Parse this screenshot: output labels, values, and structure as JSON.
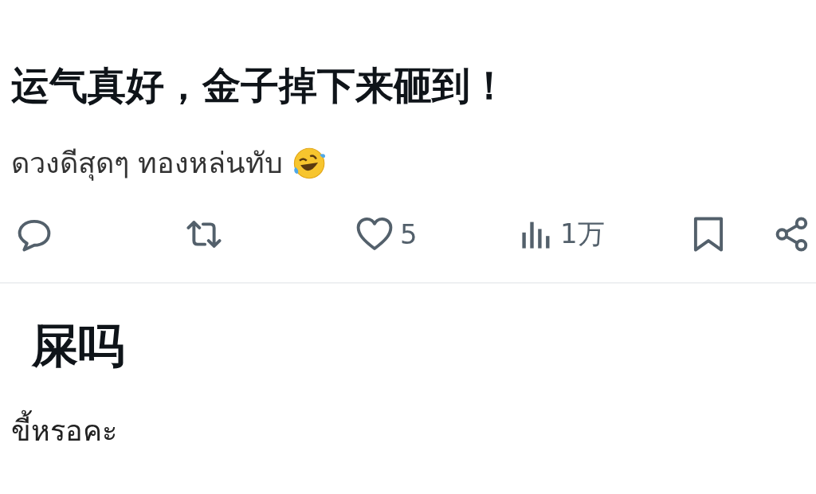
{
  "post": {
    "text": "运气真好，金子掉下来砸到！",
    "translation": "ดวงดีสุดๆ ทองหล่นทับ",
    "actions": [
      {
        "kind": "reply"
      },
      {
        "kind": "repost"
      },
      {
        "kind": "like",
        "count": "5"
      },
      {
        "kind": "views",
        "count": "1万"
      },
      {
        "kind": "bookmark"
      },
      {
        "kind": "share"
      }
    ]
  },
  "reply": {
    "text": "屎吗",
    "translation": "ขี้หรอคะ"
  }
}
